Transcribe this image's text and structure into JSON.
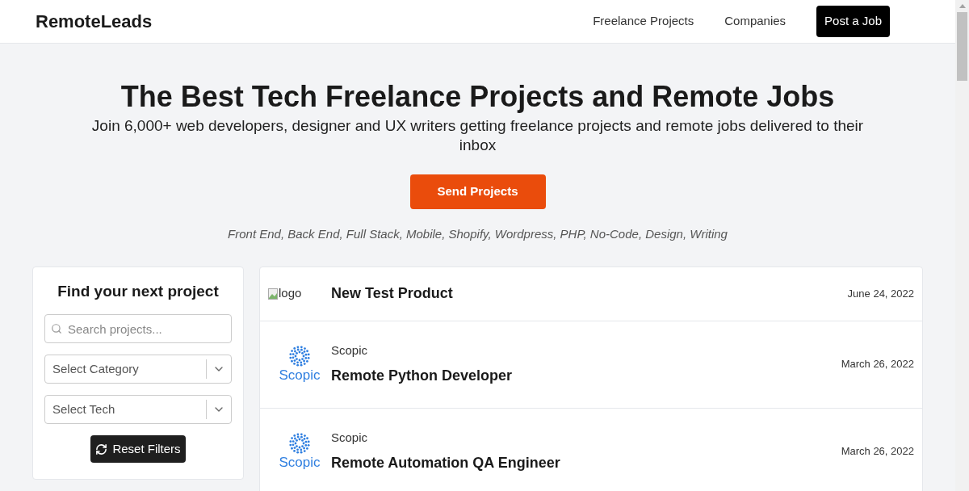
{
  "header": {
    "brand": "RemoteLeads",
    "nav": [
      "Freelance Projects",
      "Companies"
    ],
    "cta": "Post a Job"
  },
  "hero": {
    "title": "The Best Tech Freelance Projects and Remote Jobs",
    "subtitle": "Join 6,000+ web developers, designer and UX writers getting freelance projects and remote jobs delivered to their inbox",
    "button": "Send Projects",
    "tags": "Front End, Back End, Full Stack, Mobile, Shopify, Wordpress, PHP, No-Code, Design, Writing"
  },
  "filters": {
    "title": "Find your next project",
    "search": {
      "placeholder": "Search projects..."
    },
    "selects": [
      {
        "placeholder": "Select Category"
      },
      {
        "placeholder": "Select Tech"
      }
    ],
    "reset": "Reset Filters"
  },
  "jobs": [
    {
      "logo": {
        "kind": "broken",
        "alt": "logo"
      },
      "title": "New Test Product",
      "date": "June 24, 2022"
    },
    {
      "logo": {
        "kind": "scopic",
        "text": "Scopic"
      },
      "company": "Scopic",
      "title": "Remote Python Developer",
      "date": "March 26, 2022"
    },
    {
      "logo": {
        "kind": "scopic",
        "text": "Scopic"
      },
      "company": "Scopic",
      "title": "Remote Automation QA Engineer",
      "date": "March 26, 2022"
    }
  ]
}
